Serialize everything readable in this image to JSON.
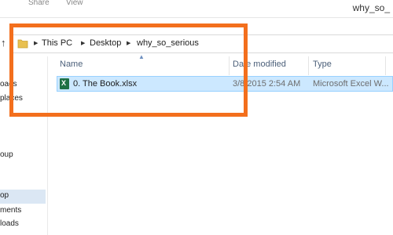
{
  "window": {
    "title": "why_so_"
  },
  "ribbon": {
    "tabs": [
      "Share",
      "View"
    ]
  },
  "address": {
    "crumbs": [
      "This PC",
      "Desktop",
      "why_so_serious"
    ]
  },
  "nav": {
    "items": [
      "oads",
      "places",
      "oup",
      "op",
      "ments",
      "loads"
    ]
  },
  "columns": {
    "name": "Name",
    "date": "Date modified",
    "type": "Type"
  },
  "files": [
    {
      "name": "0. The  Book.xlsx",
      "date": "3/8/2015 2:54 AM",
      "type": "Microsoft Excel W..."
    }
  ],
  "icons": {
    "file": "excel-file-icon",
    "folder": "folder-icon",
    "up": "up-arrow-icon"
  },
  "colors": {
    "selection": "#cce8ff",
    "annotation": "#f36f1d"
  }
}
